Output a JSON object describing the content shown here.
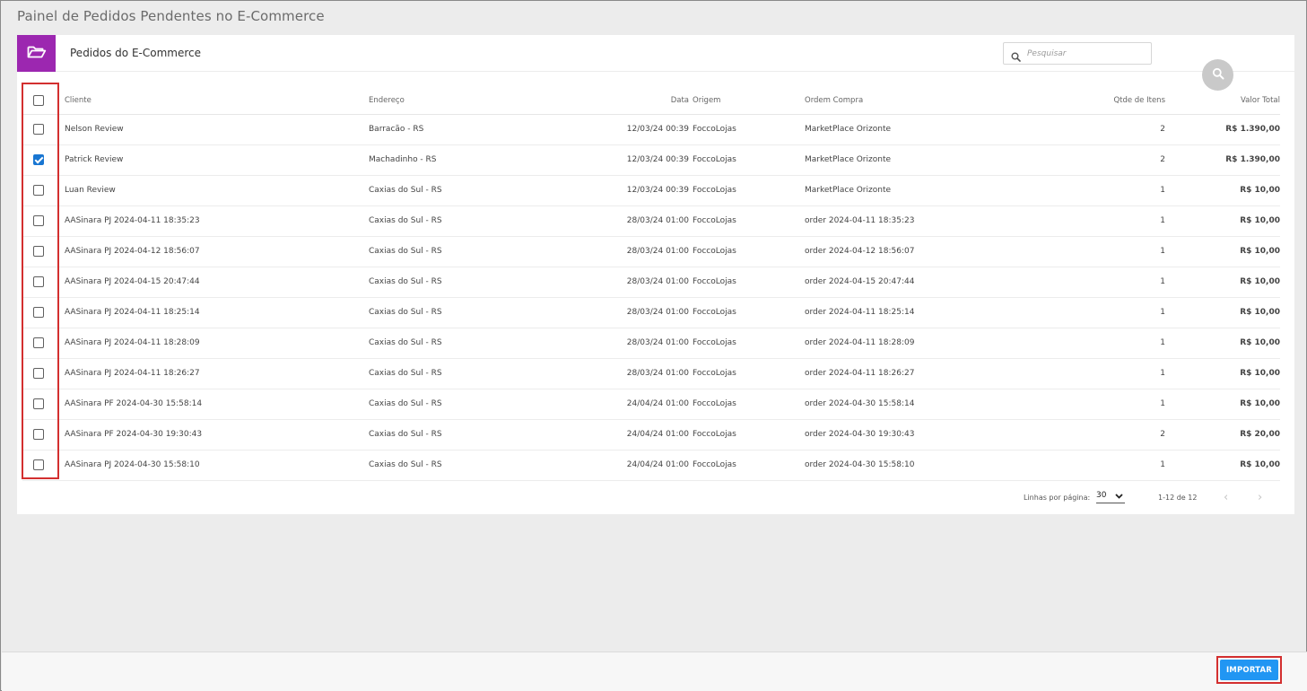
{
  "page": {
    "title": "Painel de Pedidos Pendentes no E-Commerce"
  },
  "card": {
    "title": "Pedidos do E-Commerce",
    "badge_color": "#9c27b0",
    "search_placeholder": "Pesquisar"
  },
  "table": {
    "headers": {
      "cliente": "Cliente",
      "endereco": "Endereço",
      "data": "Data",
      "origem": "Origem",
      "ordem": "Ordem Compra",
      "qtd": "Qtde de Itens",
      "valor": "Valor Total"
    },
    "rows": [
      {
        "checked": false,
        "cliente": "Nelson Review",
        "endereco": "Barracão - RS",
        "data": "12/03/24 00:39",
        "origem": "FoccoLojas",
        "ordem": "MarketPlace Orizonte",
        "qtd": "2",
        "valor": "R$ 1.390,00"
      },
      {
        "checked": true,
        "cliente": "Patrick Review",
        "endereco": "Machadinho - RS",
        "data": "12/03/24 00:39",
        "origem": "FoccoLojas",
        "ordem": "MarketPlace Orizonte",
        "qtd": "2",
        "valor": "R$ 1.390,00"
      },
      {
        "checked": false,
        "cliente": "Luan Review",
        "endereco": "Caxias do Sul - RS",
        "data": "12/03/24 00:39",
        "origem": "FoccoLojas",
        "ordem": "MarketPlace Orizonte",
        "qtd": "1",
        "valor": "R$ 10,00"
      },
      {
        "checked": false,
        "cliente": "AASinara PJ 2024-04-11 18:35:23",
        "endereco": "Caxias do Sul - RS",
        "data": "28/03/24 01:00",
        "origem": "FoccoLojas",
        "ordem": "order 2024-04-11 18:35:23",
        "qtd": "1",
        "valor": "R$ 10,00"
      },
      {
        "checked": false,
        "cliente": "AASinara PJ 2024-04-12 18:56:07",
        "endereco": "Caxias do Sul - RS",
        "data": "28/03/24 01:00",
        "origem": "FoccoLojas",
        "ordem": "order 2024-04-12 18:56:07",
        "qtd": "1",
        "valor": "R$ 10,00"
      },
      {
        "checked": false,
        "cliente": "AASinara PJ 2024-04-15 20:47:44",
        "endereco": "Caxias do Sul - RS",
        "data": "28/03/24 01:00",
        "origem": "FoccoLojas",
        "ordem": "order 2024-04-15 20:47:44",
        "qtd": "1",
        "valor": "R$ 10,00"
      },
      {
        "checked": false,
        "cliente": "AASinara PJ 2024-04-11 18:25:14",
        "endereco": "Caxias do Sul - RS",
        "data": "28/03/24 01:00",
        "origem": "FoccoLojas",
        "ordem": "order 2024-04-11 18:25:14",
        "qtd": "1",
        "valor": "R$ 10,00"
      },
      {
        "checked": false,
        "cliente": "AASinara PJ 2024-04-11 18:28:09",
        "endereco": "Caxias do Sul - RS",
        "data": "28/03/24 01:00",
        "origem": "FoccoLojas",
        "ordem": "order 2024-04-11 18:28:09",
        "qtd": "1",
        "valor": "R$ 10,00"
      },
      {
        "checked": false,
        "cliente": "AASinara PJ 2024-04-11 18:26:27",
        "endereco": "Caxias do Sul - RS",
        "data": "28/03/24 01:00",
        "origem": "FoccoLojas",
        "ordem": "order 2024-04-11 18:26:27",
        "qtd": "1",
        "valor": "R$ 10,00"
      },
      {
        "checked": false,
        "cliente": "AASinara PF 2024-04-30 15:58:14",
        "endereco": "Caxias do Sul - RS",
        "data": "24/04/24 01:00",
        "origem": "FoccoLojas",
        "ordem": "order 2024-04-30 15:58:14",
        "qtd": "1",
        "valor": "R$ 10,00"
      },
      {
        "checked": false,
        "cliente": "AASinara PF 2024-04-30 19:30:43",
        "endereco": "Caxias do Sul - RS",
        "data": "24/04/24 01:00",
        "origem": "FoccoLojas",
        "ordem": "order 2024-04-30 19:30:43",
        "qtd": "2",
        "valor": "R$ 20,00"
      },
      {
        "checked": false,
        "cliente": "AASinara PJ 2024-04-30 15:58:10",
        "endereco": "Caxias do Sul - RS",
        "data": "24/04/24 01:00",
        "origem": "FoccoLojas",
        "ordem": "order 2024-04-30 15:58:10",
        "qtd": "1",
        "valor": "R$ 10,00"
      }
    ]
  },
  "pagination": {
    "rows_label": "Linhas por página:",
    "rows_per_page": "30",
    "range": "1-12 de 12",
    "prev": "‹",
    "next": "›"
  },
  "actions": {
    "import_label": "IMPORTAR",
    "import_color": "#2196f3"
  },
  "icons": {
    "folder": "folder-open-icon",
    "search": "search-icon",
    "fab": "search-icon",
    "dropdown": "chevron-down-icon"
  }
}
